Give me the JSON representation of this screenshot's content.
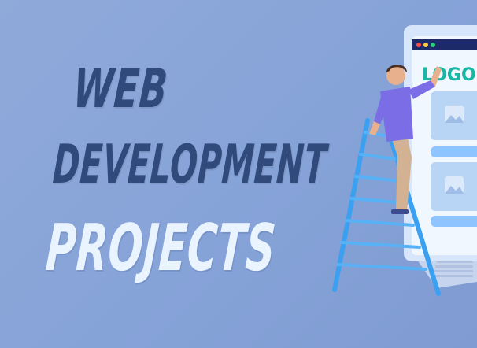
{
  "title": {
    "line1": "WEB",
    "line2": "DEVELOPMENT",
    "line3": "PROJECTS"
  },
  "illustration": {
    "logo_text": "LOGO"
  },
  "colors": {
    "background": "#8ba6db",
    "title_dark": "#2f4a7b",
    "title_light": "#e9f4ff",
    "browser_bar": "#1d2a6a",
    "logo_green": "#19b6a6",
    "ladder": "#3aa0ef",
    "shirt": "#7b6de6",
    "pants": "#d3b193"
  }
}
